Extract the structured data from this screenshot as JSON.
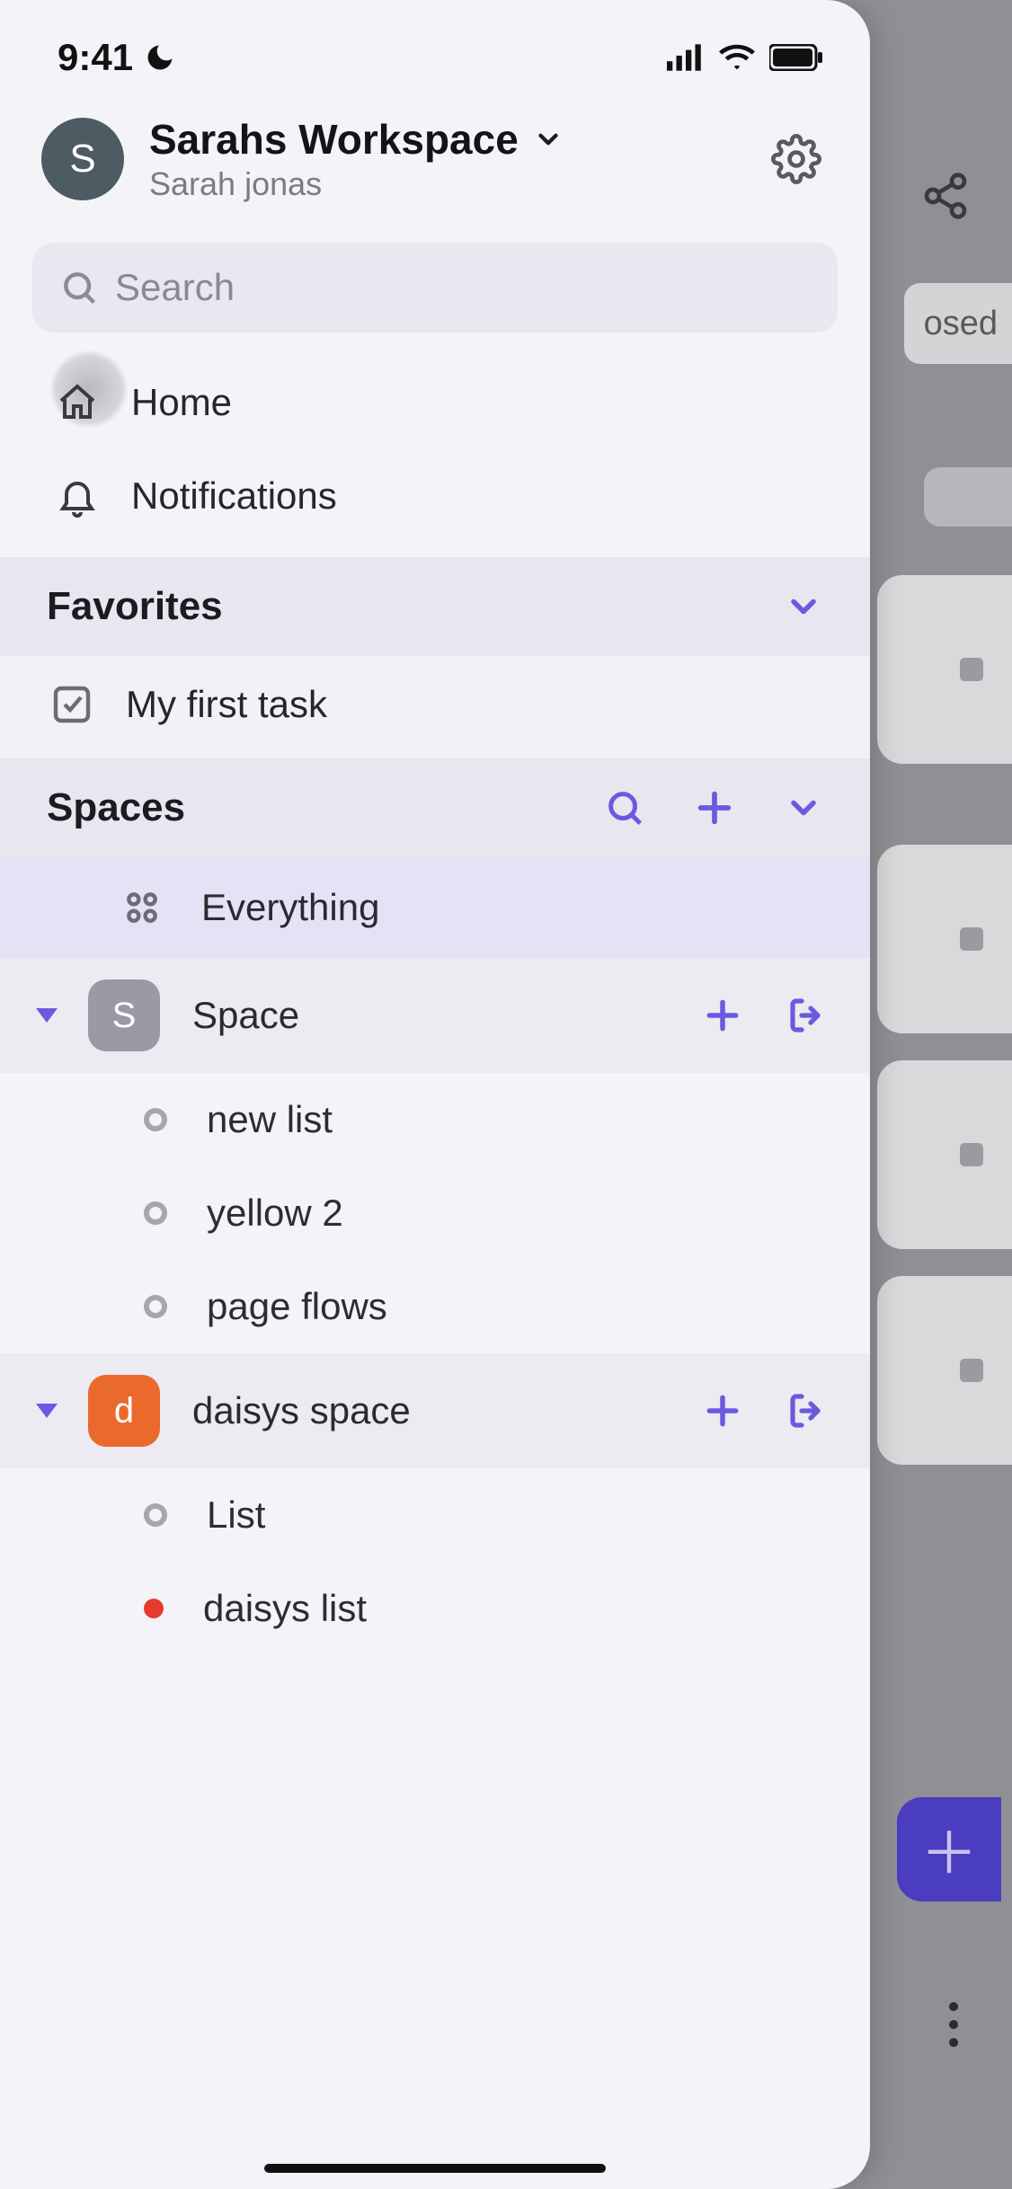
{
  "status": {
    "time": "9:41"
  },
  "workspace": {
    "name": "Sarahs Workspace",
    "user": "Sarah jonas",
    "avatar_initial": "S"
  },
  "search": {
    "placeholder": "Search"
  },
  "nav": {
    "home": "Home",
    "notifications": "Notifications"
  },
  "favorites": {
    "title": "Favorites",
    "items": [
      {
        "label": "My first task"
      }
    ]
  },
  "spaces": {
    "title": "Spaces",
    "everything": "Everything",
    "items": [
      {
        "initial": "S",
        "label": "Space",
        "color": "grey",
        "lists": [
          {
            "label": "new list"
          },
          {
            "label": "yellow 2"
          },
          {
            "label": "page flows"
          }
        ]
      },
      {
        "initial": "d",
        "label": "daisys space",
        "color": "orange",
        "lists": [
          {
            "label": "List"
          },
          {
            "label": "daisys list",
            "dot": "red"
          }
        ]
      }
    ]
  },
  "background": {
    "partial_text": "osed"
  }
}
